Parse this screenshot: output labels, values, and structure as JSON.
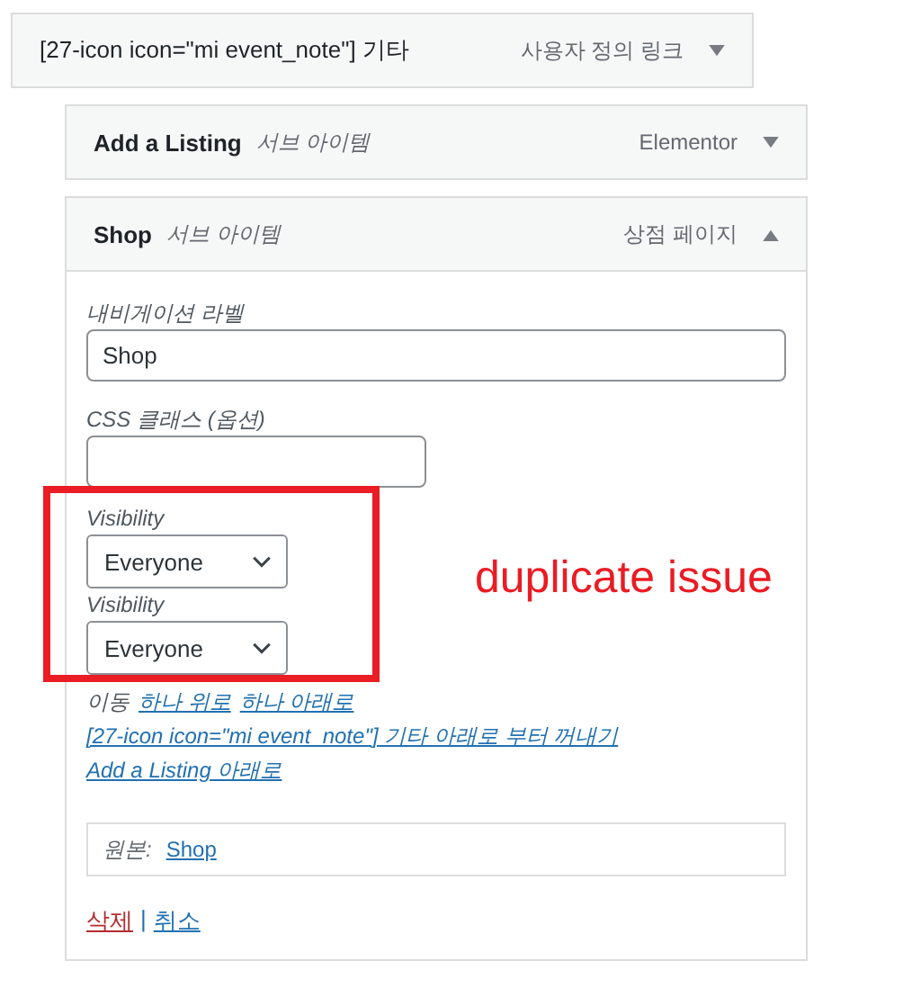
{
  "menu_items": [
    {
      "title": "[27-icon icon=\"mi event_note\"] 기타",
      "type_label": "사용자 정의 링크",
      "expanded": false,
      "children": [
        {
          "title": "Add a Listing",
          "sub_label": "서브 아이템",
          "type_label": "Elementor",
          "expanded": false
        },
        {
          "title": "Shop",
          "sub_label": "서브 아이템",
          "type_label": "상점 페이지",
          "expanded": true,
          "settings": {
            "fields": [
              {
                "kind": "text",
                "label": "내비게이션 라벨",
                "value": "Shop"
              },
              {
                "kind": "text-short",
                "label": "CSS 클래스 (옵션)"
              },
              {
                "kind": "select",
                "label": "Visibility",
                "value": "Everyone"
              },
              {
                "kind": "select",
                "label": "Visibility",
                "value": "Everyone"
              }
            ],
            "annotation": {
              "note": "duplicate issue"
            },
            "move": {
              "label": "이동",
              "inline_links": [
                "하나 위로",
                "하나 아래로"
              ],
              "links": [
                "[27-icon icon=\"mi event_note\"] 기타 아래로 부터 꺼내기",
                "Add a Listing 아래로"
              ]
            },
            "original": {
              "label": "원본:",
              "link": "Shop"
            },
            "actions": [
              {
                "kind": "delete",
                "label": "삭제"
              },
              {
                "kind": "cancel",
                "label": "취소"
              }
            ],
            "separator": "|"
          }
        }
      ]
    }
  ]
}
